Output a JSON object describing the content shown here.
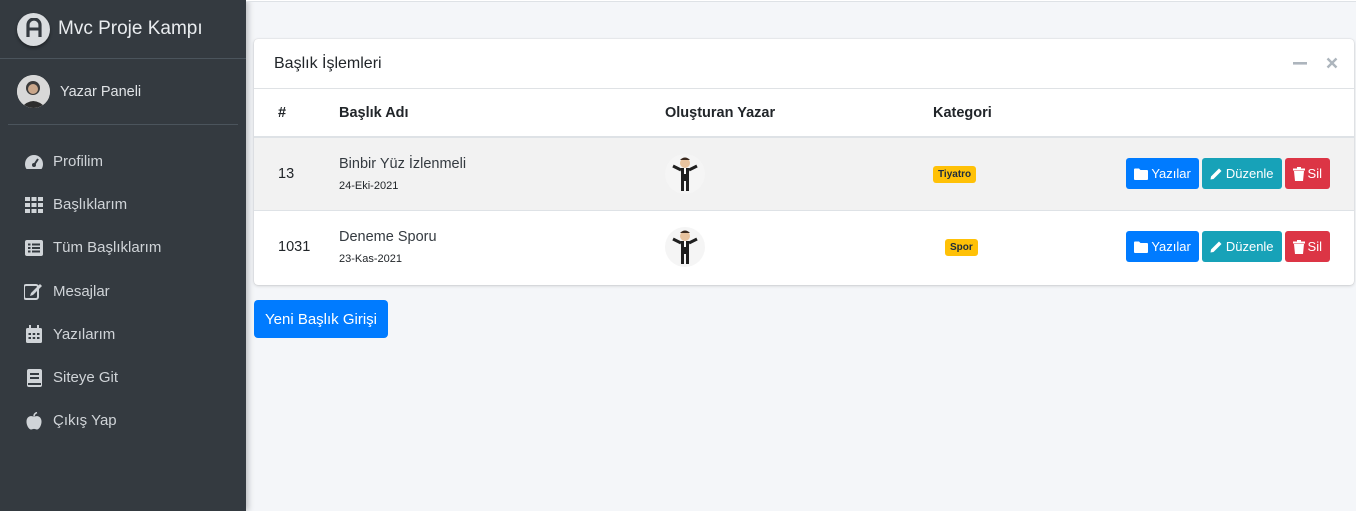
{
  "sidebar": {
    "brand": "Mvc Proje Kampı",
    "user_name": "Yazar Paneli",
    "items": [
      {
        "label": "Profilim",
        "icon": "tachometer-icon"
      },
      {
        "label": "Başlıklarım",
        "icon": "grid-icon"
      },
      {
        "label": "Tüm Başlıklarım",
        "icon": "list-icon"
      },
      {
        "label": "Mesajlar",
        "icon": "edit-icon"
      },
      {
        "label": "Yazılarım",
        "icon": "calendar-icon"
      },
      {
        "label": "Siteye Git",
        "icon": "book-icon"
      },
      {
        "label": "Çıkış Yap",
        "icon": "apple-icon"
      }
    ]
  },
  "card": {
    "title": "Başlık İşlemleri",
    "columns": [
      "#",
      "Başlık Adı",
      "Oluşturan Yazar",
      "Kategori",
      ""
    ],
    "rows": [
      {
        "id": "13",
        "title": "Binbir Yüz İzlenmeli",
        "date": "24-Eki-2021",
        "category": "Tiyatro"
      },
      {
        "id": "1031",
        "title": "Deneme Sporu",
        "date": "23-Kas-2021",
        "category": "Spor"
      }
    ],
    "actions": {
      "posts": "Yazılar",
      "edit": "Düzenle",
      "delete": "Sil"
    }
  },
  "new_button": "Yeni Başlık Girişi",
  "colors": {
    "sidebar_bg": "#343a40",
    "primary": "#007bff",
    "info": "#17a2b8",
    "danger": "#dc3545",
    "warning": "#ffc107",
    "page_bg": "#f4f6f9"
  }
}
